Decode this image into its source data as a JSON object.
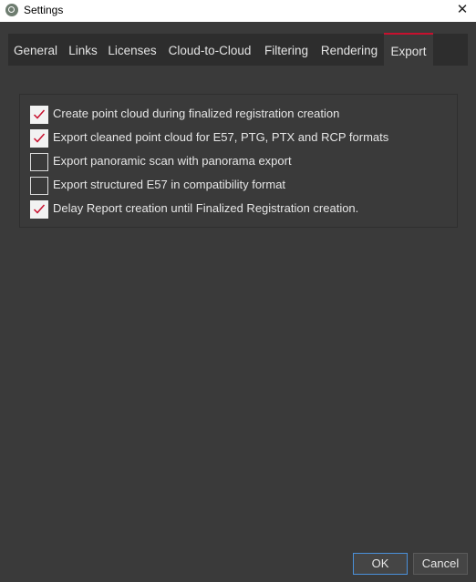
{
  "window": {
    "title": "Settings",
    "close_glyph": "✕"
  },
  "tabs": [
    {
      "label": "General",
      "active": false
    },
    {
      "label": "Links",
      "active": false
    },
    {
      "label": "Licenses",
      "active": false
    },
    {
      "label": "Cloud-to-Cloud",
      "active": false
    },
    {
      "label": "Filtering",
      "active": false
    },
    {
      "label": "Rendering",
      "active": false
    },
    {
      "label": "Export",
      "active": true
    }
  ],
  "export_options": [
    {
      "label": "Create point cloud during finalized registration creation",
      "checked": true
    },
    {
      "label": "Export cleaned point cloud for E57, PTG, PTX and RCP formats",
      "checked": true
    },
    {
      "label": "Export panoramic scan with panorama export",
      "checked": false
    },
    {
      "label": "Export structured E57 in compatibility format",
      "checked": false
    },
    {
      "label": "Delay Report creation until Finalized Registration creation.",
      "checked": true
    }
  ],
  "buttons": {
    "ok": "OK",
    "cancel": "Cancel"
  },
  "colors": {
    "accent": "#c8102e",
    "focus_border": "#4a90d9",
    "background": "#3a3a3a"
  },
  "icons": {
    "app": "app-logo-icon",
    "close": "close-icon",
    "check": "checkmark-icon"
  }
}
